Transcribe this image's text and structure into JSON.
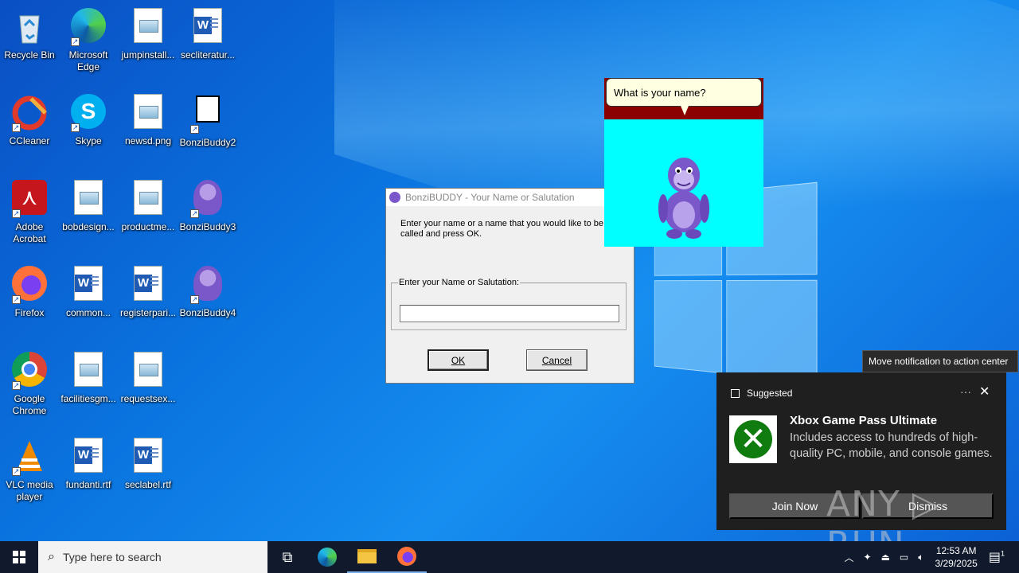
{
  "desktop": {
    "icons": [
      {
        "label": "Recycle Bin",
        "icon": "recycle-bin-icon"
      },
      {
        "label": "Microsoft Edge",
        "icon": "edge-icon"
      },
      {
        "label": "jumpinstall...",
        "icon": "image-file-icon"
      },
      {
        "label": "secliteratur...",
        "icon": "word-doc-icon"
      },
      {
        "label": "CCleaner",
        "icon": "ccleaner-icon"
      },
      {
        "label": "Skype",
        "icon": "skype-icon"
      },
      {
        "label": "newsd.png",
        "icon": "image-file-icon"
      },
      {
        "label": "BonziBuddy2",
        "icon": "bonzibuddy-icon"
      },
      {
        "label": "Adobe Acrobat",
        "icon": "acrobat-icon"
      },
      {
        "label": "bobdesign...",
        "icon": "image-file-icon"
      },
      {
        "label": "productme...",
        "icon": "image-file-icon"
      },
      {
        "label": "BonziBuddy3",
        "icon": "bonzibuddy-icon"
      },
      {
        "label": "Firefox",
        "icon": "firefox-icon"
      },
      {
        "label": "common...",
        "icon": "word-doc-icon"
      },
      {
        "label": "registerpari...",
        "icon": "word-doc-icon"
      },
      {
        "label": "BonziBuddy4",
        "icon": "bonzibuddy-icon"
      },
      {
        "label": "Google Chrome",
        "icon": "chrome-icon"
      },
      {
        "label": "facilitiesgm...",
        "icon": "image-file-icon"
      },
      {
        "label": "requestsex...",
        "icon": "image-file-icon"
      },
      {
        "label": "VLC media player",
        "icon": "vlc-icon"
      },
      {
        "label": "fundanti.rtf",
        "icon": "word-doc-icon"
      },
      {
        "label": "seclabel.rtf",
        "icon": "word-doc-icon"
      }
    ]
  },
  "dialog": {
    "title": "BonziBUDDY - Your Name or Salutation",
    "message": "Enter your name or a name that you would like to be called and press OK.",
    "group_label": "Enter your Name or Salutation:",
    "input_value": "",
    "ok_label": "OK",
    "cancel_label": "Cancel"
  },
  "bonzi": {
    "speech": "What is your name?"
  },
  "notification": {
    "tooltip": "Move notification to action center",
    "header": "Suggested",
    "more": "···",
    "close": "✕",
    "title": "Xbox Game Pass Ultimate",
    "body": "Includes access to hundreds of high-quality PC, mobile, and console games.",
    "join_label": "Join Now",
    "dismiss_label": "Dismiss",
    "watermark": "ANY ▷ RUN"
  },
  "taskbar": {
    "search_placeholder": "Type here to search",
    "time": "12:53 AM",
    "date": "3/29/2025",
    "notification_count": "1"
  },
  "colors": {
    "desktop_blue": "#0a74df",
    "dialog_bg": "#f0f0f0",
    "bonzi_stage": "#00ffff",
    "toast_bg": "#1f1f1f",
    "taskbar_bg": "#101a2c"
  }
}
